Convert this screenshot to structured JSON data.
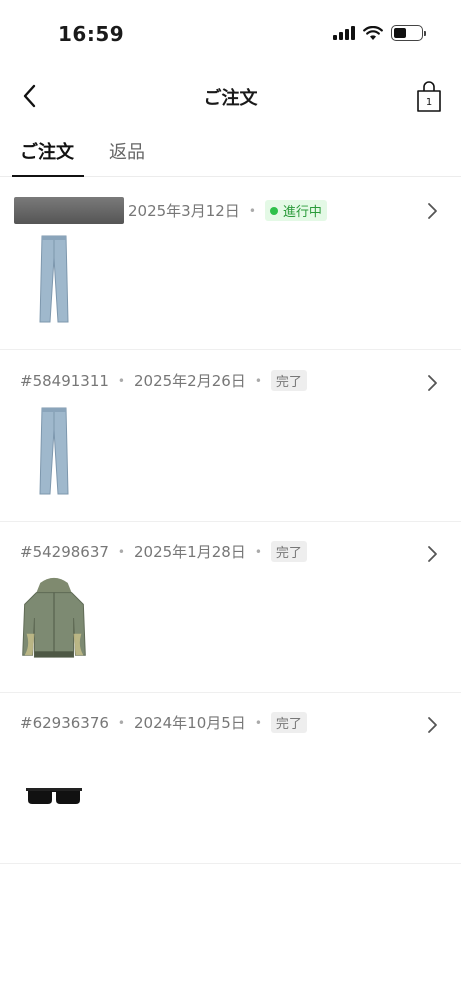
{
  "status_bar": {
    "time": "16:59"
  },
  "nav": {
    "title": "ご注文",
    "bag_count": "1"
  },
  "tabs": [
    {
      "label": "ご注文"
    },
    {
      "label": "返品"
    }
  ],
  "orders": [
    {
      "order_number": "",
      "date": "2025年3月12日",
      "status": "進行中",
      "item": "jeans-thumbnail"
    },
    {
      "order_number": "#58491311",
      "date": "2025年2月26日",
      "status": "完了",
      "item": "jeans-thumbnail"
    },
    {
      "order_number": "#54298637",
      "date": "2025年1月28日",
      "status": "完了",
      "item": "jacket-thumbnail"
    },
    {
      "order_number": "#62936376",
      "date": "2024年10月5日",
      "status": "完了",
      "item": "sunglasses-thumbnail"
    }
  ],
  "colors": {
    "progress_green": "#2ec04a",
    "progress_bg": "#e4f9e6",
    "done_bg": "#eeeeee"
  }
}
